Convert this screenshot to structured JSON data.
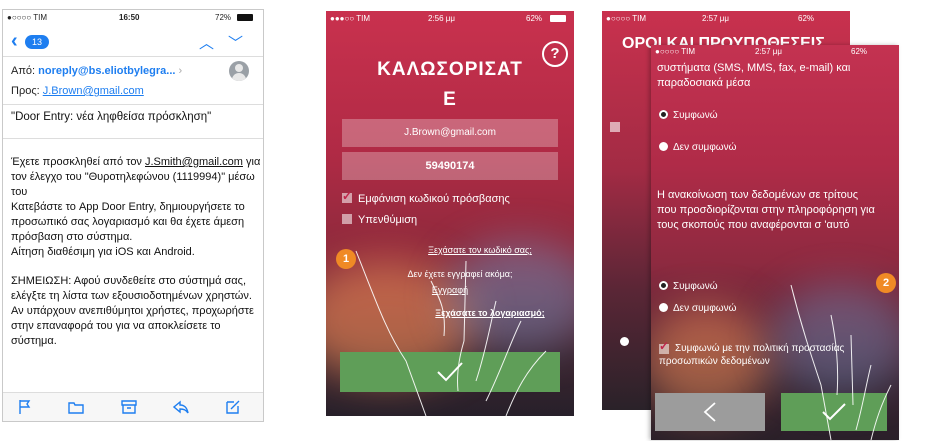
{
  "phone1": {
    "status": {
      "carrier": "●○○○○ TIM",
      "time": "16:50",
      "battery": "72%"
    },
    "nav": {
      "badge": "13"
    },
    "from_label": "Από:",
    "from_value": "noreply@bs.eliotbylegra...",
    "to_label": "Προς:",
    "to_value": "J.Brown@gmail.com",
    "subject": "\"Door Entry: νέα ληφθείσα πρόσκληση\"",
    "body_p1_a": "Έχετε προσκληθεί από τον ",
    "body_p1_link": "J.Smith@gmail.com",
    "body_p1_b": " για τον έλεγχο του \"Θυροτηλεφώνου (1119994)\" μέσω του",
    "body_p2": "Κατεβάστε το App Door Entry, δημιουργήσετε το προσωπικό σας λογαριασμό και θα έχετε άμεση πρόσβαση στο σύστημα.",
    "body_p3": "Αίτηση διαθέσιμη για iOS και Android.",
    "body_p4": "ΣΗΜΕΙΩΣΗ: Αφού συνδεθείτε στο σύστημά σας, ελέγξτε τη λίστα των εξουσιοδοτημένων χρηστών.",
    "body_p5": "Αν υπάρχουν ανεπιθύμητοι χρήστες, προχωρήστε στην επαναφορά του για να αποκλείσετε το σύστημα."
  },
  "phone2": {
    "status": {
      "carrier": "●●●○○ TIM",
      "time": "2:56 μμ",
      "battery": "62%"
    },
    "welcome_1": "ΚΑΛΩΣΟΡΙΣΑΤ",
    "welcome_2": "Ε",
    "help": "?",
    "email": "J.Brown@gmail.com",
    "code": "59490174",
    "show_password": "Εμφάνιση κωδικού πρόσβασης",
    "remember": "Υπενθύμιση",
    "forgot": "Ξεχάσατε τον κωδικό σας;",
    "not_registered": "Δεν έχετε εγγραφεί ακόμα;",
    "register": "Εγγραφή",
    "forgot_account": "Ξεχάσατε το λογαριασμό;",
    "step": "1"
  },
  "phone3": {
    "status_back": {
      "carrier": "●○○○○ TIM",
      "time": "2:57 μμ",
      "battery": "62%"
    },
    "status_front": {
      "carrier": "●○○○○ TIM",
      "time": "2:57 μμ",
      "battery": "62%"
    },
    "back_title": "ΟΡΟΙ ΚΑΙ ΠΡΟΥΠΟΘΕΣΕΙΣ",
    "intro": "συστήματα (SMS, MMS, fax, e-mail) και παραδοσιακά μέσα",
    "agree_1": "Συμφωνώ",
    "disagree_1": "Δεν συμφωνώ",
    "disclosure": "Η ανακοίνωση των δεδομένων σε τρίτους που προσδιορίζονται στην πληροφόρηση για τους σκοπούς που αναφέρονται σ 'αυτό",
    "agree_2": "Συμφωνώ",
    "disagree_2": "Δεν συμφωνώ",
    "privacy": "Συμφωνώ με την πολιτική προστασίας προσωπικών δεδομένων",
    "step": "2"
  }
}
